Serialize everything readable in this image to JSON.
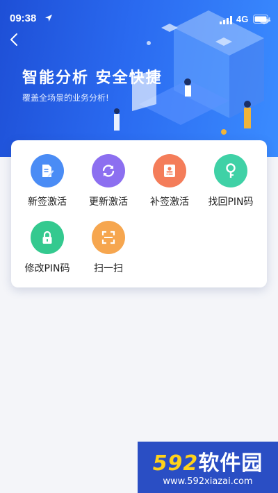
{
  "status_bar": {
    "time": "09:38",
    "network": "4G",
    "icons": [
      "location-icon",
      "signal-icon",
      "battery-icon"
    ]
  },
  "header": {
    "back_icon": "chevron-left-icon",
    "title": "智能分析 安全快捷",
    "subtitle": "覆盖全场景的业务分析!"
  },
  "actions": [
    {
      "label": "新签激活",
      "icon": "document-edit-icon",
      "color": "#4a8cf5"
    },
    {
      "label": "更新激活",
      "icon": "refresh-icon",
      "color": "#8c6ff0"
    },
    {
      "label": "补签激活",
      "icon": "id-card-icon",
      "color": "#f47d5a"
    },
    {
      "label": "找回PIN码",
      "icon": "key-icon",
      "color": "#3fd1a6"
    },
    {
      "label": "修改PIN码",
      "icon": "lock-icon",
      "color": "#34c98f"
    },
    {
      "label": "扫一扫",
      "icon": "scan-icon",
      "color": "#f6a64f"
    }
  ],
  "watermark": {
    "brand_num": "592",
    "brand_text": "软件园",
    "url": "www.592xiazai.com"
  },
  "colors": {
    "banner": "#2a6af0",
    "background": "#f4f5f9"
  }
}
